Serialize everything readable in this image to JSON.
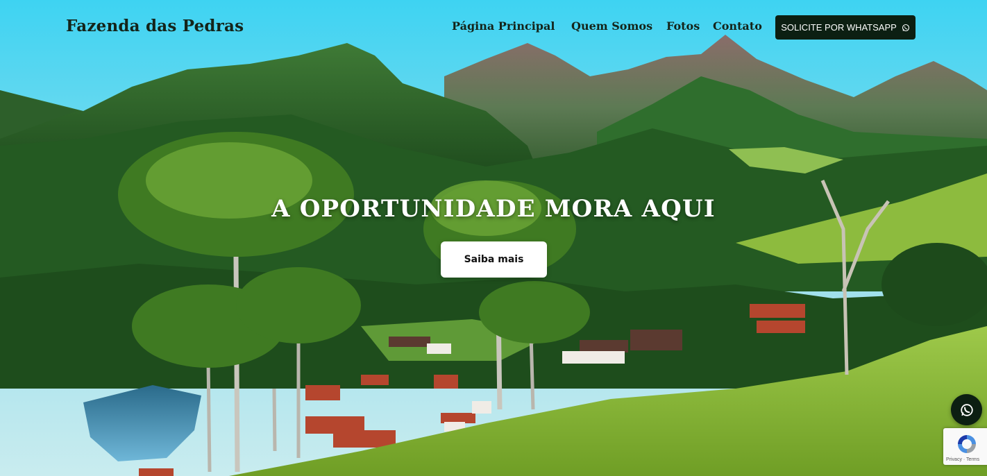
{
  "brand": {
    "name": "Fazenda das Pedras"
  },
  "nav": {
    "items": [
      {
        "label": "Página Principal"
      },
      {
        "label": "Quem Somos"
      },
      {
        "label": "Fotos"
      },
      {
        "label": "Contato"
      }
    ],
    "whatsapp_label": "SOLICITE POR WHATSAPP"
  },
  "hero": {
    "headline": "A OPORTUNIDADE MORA AQUI",
    "cta_label": "Saiba mais"
  },
  "floating": {
    "icon": "whatsapp-icon"
  },
  "recaptcha": {
    "terms": "Privacy · Terms"
  },
  "colors": {
    "dark_green": "#0c1f12",
    "sky": "#8ecfe0",
    "white": "#ffffff"
  }
}
